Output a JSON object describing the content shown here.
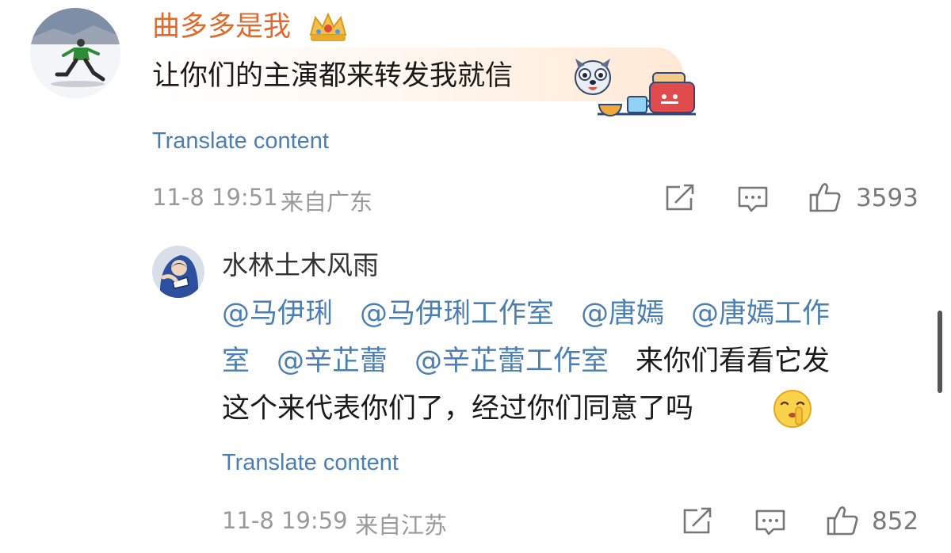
{
  "comment": {
    "username": "曲多多是我",
    "text": "让你们的主演都来转发我就信",
    "translate_label": "Translate content",
    "timestamp": "11-8 19:51",
    "location": "来自广东",
    "like_count": "3593"
  },
  "reply": {
    "username": "水林土木风雨",
    "mentions": [
      "@马伊琍",
      "@马伊琍工作室",
      "@唐嫣",
      "@唐嫣工作",
      "室",
      "@辛芷蕾",
      "@辛芷蕾工作室"
    ],
    "text_line2": "来你们看看它发",
    "text_line3": "这个来代表你们了，经过你们同意了吗",
    "translate_label": "Translate content",
    "timestamp": "11-8 19:59",
    "location": "来自江苏",
    "like_count": "852"
  },
  "icons": [
    "crown-badge-icon",
    "dog-face-emoji",
    "breakfast-toaster-decoration",
    "repost-icon",
    "comment-icon",
    "like-icon",
    "shushing-face-emoji"
  ],
  "colors": {
    "username": "#e06a2c",
    "link": "#4b7fb3",
    "meta": "#9a9a9a",
    "icon": "#777777"
  }
}
